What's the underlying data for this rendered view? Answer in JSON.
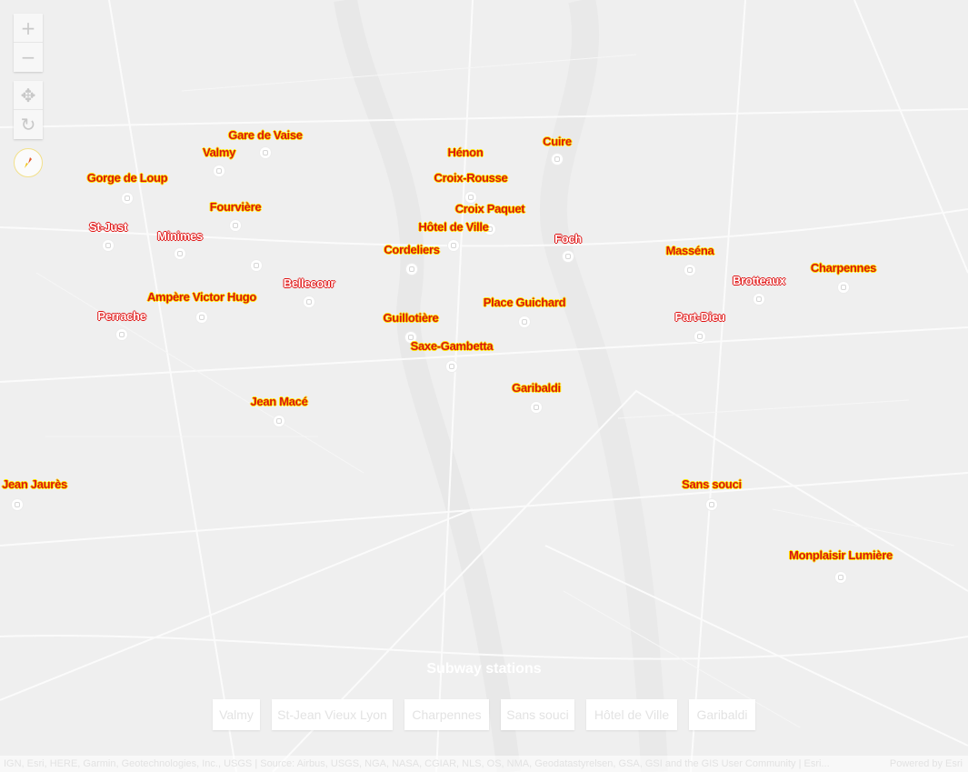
{
  "controls": {
    "zoom_in": "+",
    "zoom_out": "−",
    "pan": "✥",
    "rotate": "↻"
  },
  "stations": [
    {
      "name": "Gare de Vaise",
      "style": "red"
    },
    {
      "name": "Valmy",
      "style": "red"
    },
    {
      "name": "Gorge de Loup",
      "style": "red"
    },
    {
      "name": "Fourvière",
      "style": "red"
    },
    {
      "name": "St-Just",
      "style": "white"
    },
    {
      "name": "Minimes",
      "style": "white"
    },
    {
      "name": "Bellecour",
      "style": "white"
    },
    {
      "name": "Ampère Victor Hugo",
      "style": "red"
    },
    {
      "name": "Perrache",
      "style": "white"
    },
    {
      "name": "Hénon",
      "style": "red"
    },
    {
      "name": "Cuire",
      "style": "red"
    },
    {
      "name": "Croix-Rousse",
      "style": "red"
    },
    {
      "name": "Croix Paquet",
      "style": "red"
    },
    {
      "name": "Hôtel de Ville",
      "style": "red"
    },
    {
      "name": "Cordeliers",
      "style": "red"
    },
    {
      "name": "Foch",
      "style": "white"
    },
    {
      "name": "Masséna",
      "style": "red"
    },
    {
      "name": "Charpennes",
      "style": "red"
    },
    {
      "name": "Brotteaux",
      "style": "white"
    },
    {
      "name": "Place Guichard",
      "style": "red"
    },
    {
      "name": "Guillotière",
      "style": "red"
    },
    {
      "name": "Part-Dieu",
      "style": "white"
    },
    {
      "name": "Saxe-Gambetta",
      "style": "red"
    },
    {
      "name": "Garibaldi",
      "style": "red"
    },
    {
      "name": "Jean Macé",
      "style": "red"
    },
    {
      "name": "Jean Jaurès",
      "style": "red"
    },
    {
      "name": "Sans souci",
      "style": "red"
    },
    {
      "name": "Monplaisir Lumière",
      "style": "red"
    }
  ],
  "bookmarks": {
    "title": "Subway stations",
    "items": [
      "Valmy",
      "St-Jean Vieux Lyon",
      "Charpennes",
      "Sans souci",
      "Hôtel de Ville",
      "Garibaldi"
    ]
  },
  "attribution": {
    "text": "IGN, Esri, HERE, Garmin, Geotechnologies, Inc., USGS | Source: Airbus, USGS, NGA, NASA, CGIAR, NLS, OS, NMA, Geodatastyrelsen, GSA, GSI and the GIS User Community | Esri...",
    "powered_by": "Powered by Esri"
  },
  "colors": {
    "map_background": "#efefef",
    "road": "#ffffff",
    "label_fill": "#d81414",
    "label_halo": "#ffe600"
  }
}
